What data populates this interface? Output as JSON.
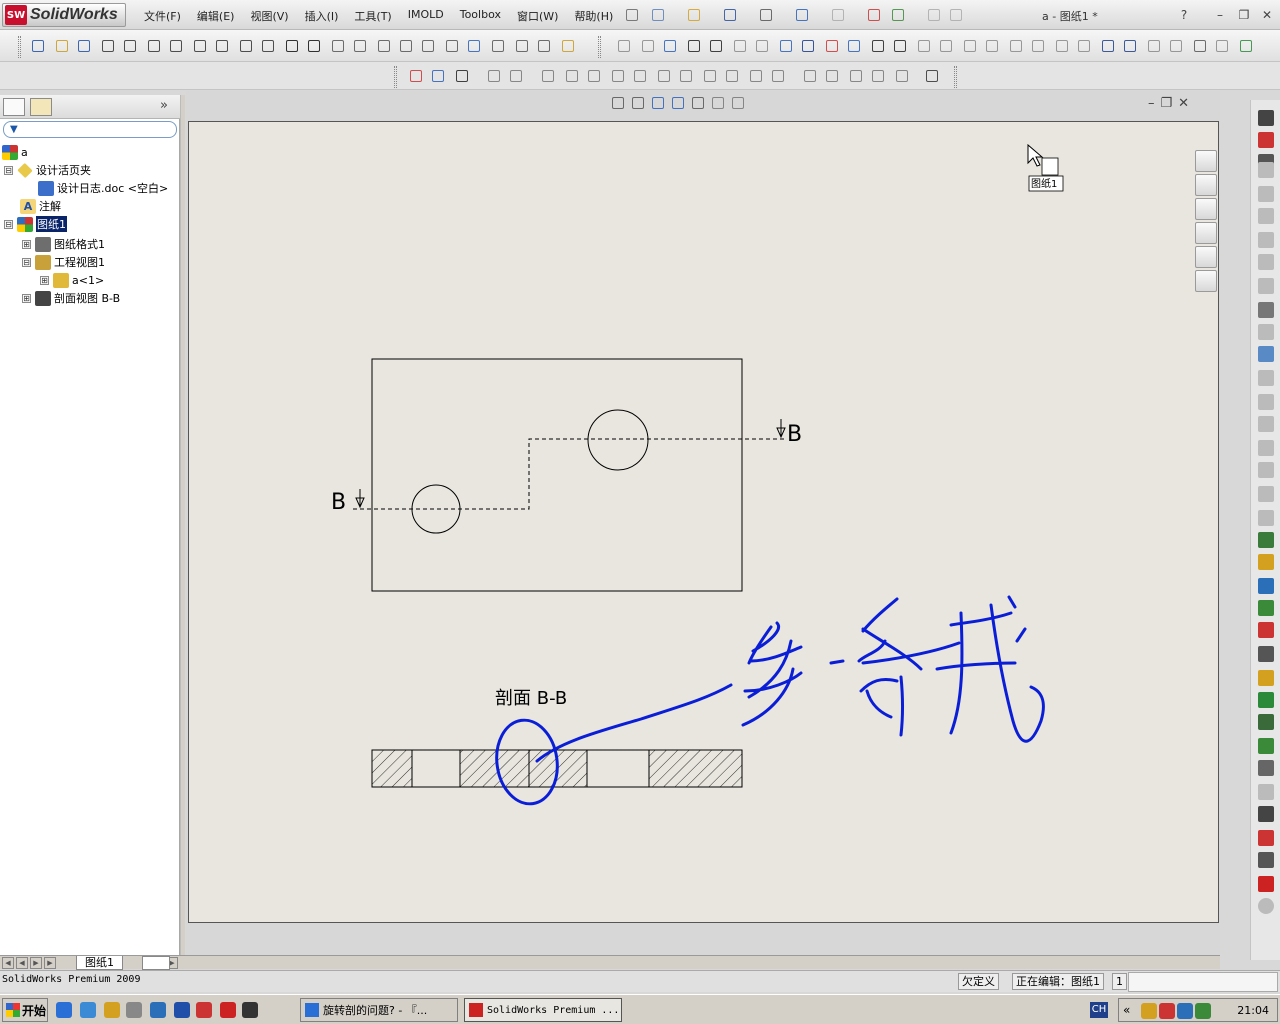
{
  "app": {
    "logo_text": "SolidWorks",
    "logo_badge": "SW",
    "window_title": "a - 图纸1 *",
    "help_label": "?"
  },
  "menu": [
    {
      "label": "文件(F)"
    },
    {
      "label": "编辑(E)"
    },
    {
      "label": "视图(V)"
    },
    {
      "label": "插入(I)"
    },
    {
      "label": "工具(T)"
    },
    {
      "label": "IMOLD"
    },
    {
      "label": "Toolbox"
    },
    {
      "label": "窗口(W)"
    },
    {
      "label": "帮助(H)"
    }
  ],
  "tree": {
    "root": "a",
    "items": [
      {
        "label": "设计活页夹",
        "expander": "⊟"
      },
      {
        "label": "设计日志.doc <空白>",
        "expander": ""
      },
      {
        "label": "注解",
        "expander": ""
      },
      {
        "label": "图纸1",
        "expander": "⊟"
      },
      {
        "label": "图纸格式1",
        "expander": "⊞"
      },
      {
        "label": "工程视图1",
        "expander": "⊟"
      },
      {
        "label": "a<1>",
        "expander": "⊞"
      },
      {
        "label": "剖面视图 B-B",
        "expander": "⊞"
      }
    ],
    "icon_colors": [
      "#e9c94a",
      "#3b6fc9",
      "#f5d57a",
      "#2f6dbd",
      "#6e6e6e",
      "#c9a13a",
      "#e0b83a",
      "#444444"
    ]
  },
  "drawing": {
    "section_label_left": "B",
    "section_label_right": "B",
    "section_title": "剖面 B-B",
    "cursor_tag": "图纸1",
    "annotation_handwriting": "多一条线",
    "annotation_color": "#0a1ed8"
  },
  "sheet_tab": "图纸1",
  "status": {
    "app_name": "SolidWorks Premium 2009",
    "defined_state": "欠定义",
    "editing": "正在编辑：图纸1",
    "extra": "1"
  },
  "taskbar": {
    "start_label": "开始",
    "tasks": [
      {
        "label": "旋转剖的问题? - 『..."
      },
      {
        "label": "SolidWorks Premium ..."
      }
    ],
    "lang": "CH",
    "clock": "21:04"
  },
  "colors": {
    "sheet_bg": "#e8e6de",
    "selection": "#0a246a",
    "handwriting": "#0a1ed8"
  }
}
